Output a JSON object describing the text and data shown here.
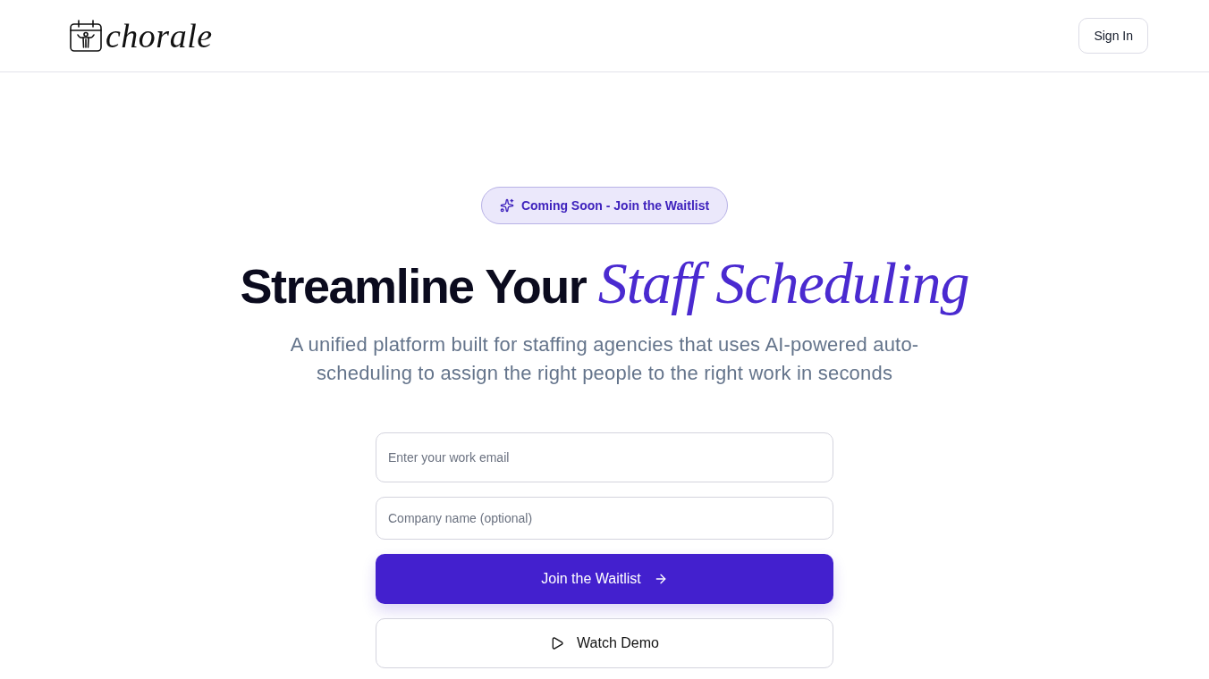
{
  "header": {
    "logo_text": "chorale",
    "sign_in": "Sign In"
  },
  "hero": {
    "badge": "Coming Soon - Join the Waitlist",
    "headline": "Streamline Your *Staff Scheduling*",
    "subtitle": "A unified platform built for staffing agencies that uses AI-powered auto-scheduling to assign the right people to the right work in seconds"
  },
  "form": {
    "fields": [
      {
        "kind": "email",
        "placeholder": "Enter your work email"
      },
      {
        "kind": "text",
        "placeholder": "Company name (optional)"
      }
    ],
    "buttons": [
      {
        "kind": "primary",
        "label": "Join the Waitlist"
      },
      {
        "kind": "secondary",
        "label": "Watch Demo"
      }
    ]
  }
}
